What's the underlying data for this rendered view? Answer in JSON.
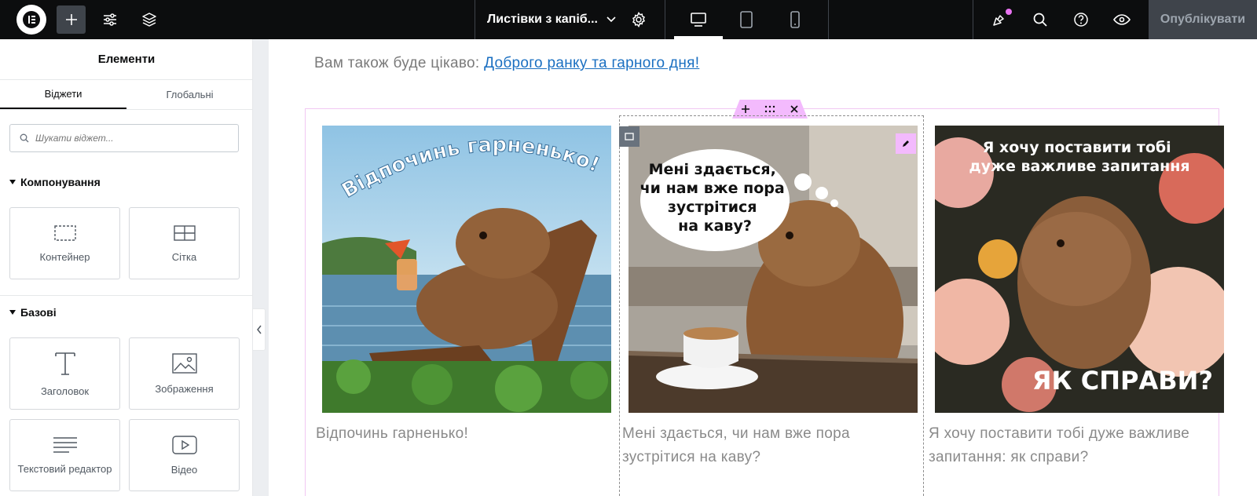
{
  "topbar": {
    "page_title": "Листівки з капіб...",
    "publish_label": "Опублікувати",
    "icons": [
      "elementor-logo-icon",
      "plus-icon",
      "sliders-icon",
      "layers-icon",
      "chevron-down-icon",
      "gear-icon",
      "desktop-icon",
      "tablet-icon",
      "mobile-icon",
      "whats-new-icon",
      "search-icon",
      "help-icon",
      "eye-icon"
    ]
  },
  "panel": {
    "title": "Елементи",
    "tabs": [
      {
        "label": "Віджети",
        "active": true
      },
      {
        "label": "Глобальні",
        "active": false
      }
    ],
    "search_placeholder": "Шукати віджет...",
    "categories": [
      {
        "label": "Компонування",
        "widgets": [
          {
            "label": "Контейнер",
            "icon": "container-icon"
          },
          {
            "label": "Сітка",
            "icon": "grid-icon"
          }
        ]
      },
      {
        "label": "Базові",
        "widgets": [
          {
            "label": "Заголовок",
            "icon": "heading-icon"
          },
          {
            "label": "Зображення",
            "icon": "image-icon"
          },
          {
            "label": "Текстовий редактор",
            "icon": "text-editor-icon"
          },
          {
            "label": "Відео",
            "icon": "video-icon"
          }
        ]
      }
    ]
  },
  "canvas": {
    "also_prefix": "Вам також буде цікаво: ",
    "also_link": "Доброго ранку та гарного дня!",
    "cards": [
      {
        "image_text": "Відпочинь гарненько!",
        "caption": "Відпочинь гарненько!"
      },
      {
        "image_text": "Мені здається, чи нам вже пора зустрітися на каву?",
        "caption": "Мені здається, чи нам вже пора зустрітися на каву?"
      },
      {
        "image_text_top": "Я хочу поставити тобі дуже важливе запитання",
        "image_text_bottom": "ЯК СПРАВИ?",
        "caption": "Я хочу поставити тобі дуже важливе запитання: як справи?"
      }
    ]
  },
  "colors": {
    "accent_pink": "#f3bafd",
    "link_blue": "#1a6fc1",
    "topbar": "#0c0d0e"
  }
}
